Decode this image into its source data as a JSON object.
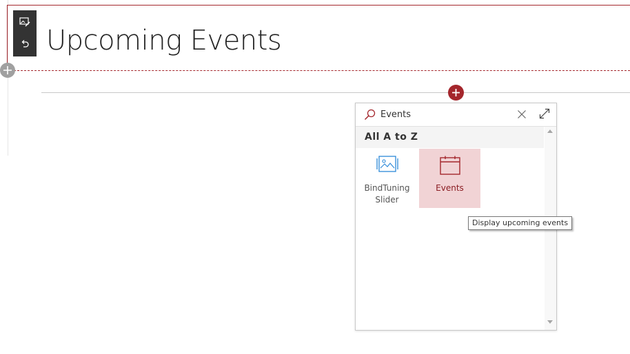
{
  "page": {
    "title": "Upcoming Events"
  },
  "toolbar": {
    "items": [
      {
        "icon": "edit-image-icon"
      },
      {
        "icon": "undo-icon"
      }
    ]
  },
  "colors": {
    "accent": "#a4262c",
    "selected_tile_bg": "#f1d3d5",
    "slider_icon": "#2b88d8",
    "toolbar_bg": "#333333"
  },
  "toolbox": {
    "search": {
      "value": "Events",
      "placeholder": ""
    },
    "group_header": "All A to Z",
    "tiles": [
      {
        "label_line1": "BindTuning",
        "label_line2": "Slider",
        "icon": "slider-image-icon"
      },
      {
        "label": "Events",
        "icon": "calendar-icon",
        "selected": true
      }
    ],
    "tooltip": "Display upcoming events"
  }
}
